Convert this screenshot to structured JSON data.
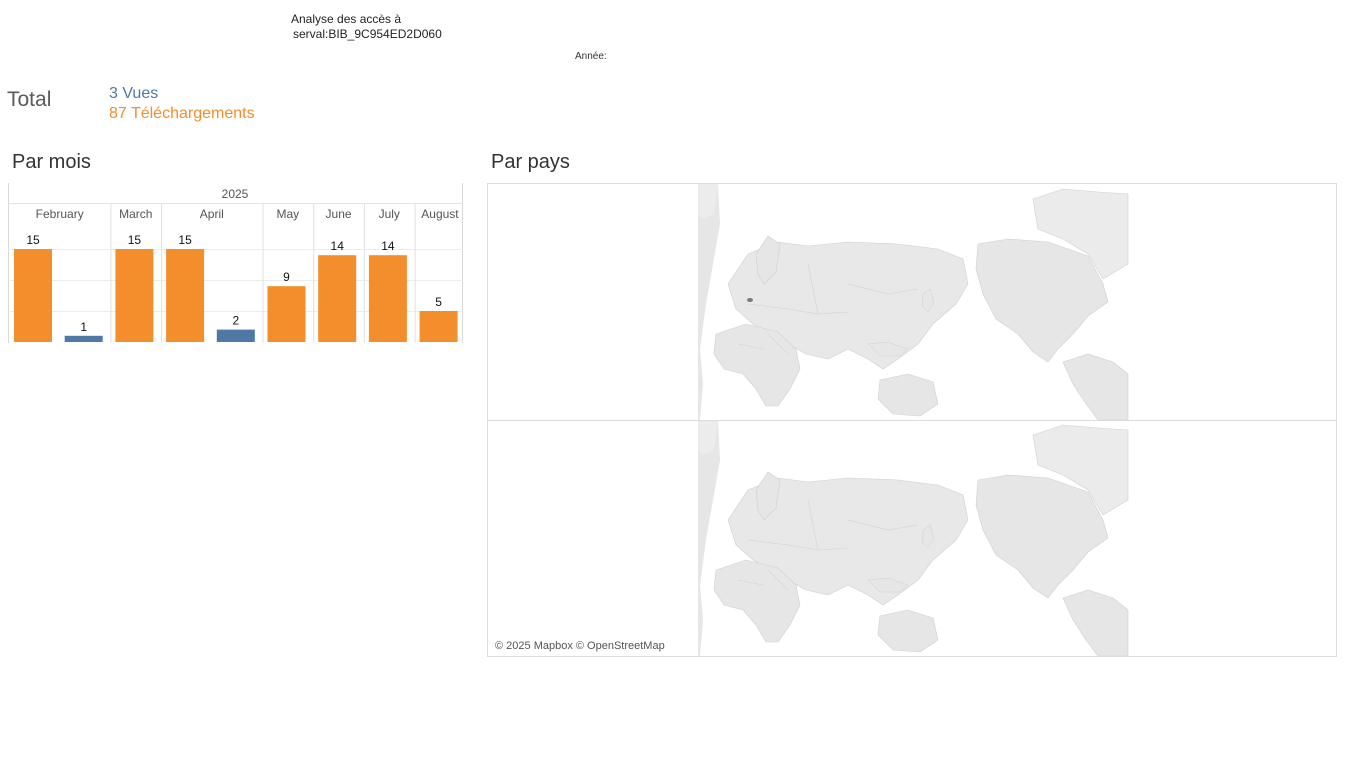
{
  "header": {
    "title_line1": "Analyse des accès à",
    "title_line2": "serval:BIB_9C954ED2D060",
    "year_filter_label": "Année:"
  },
  "totals": {
    "label": "Total",
    "vues": "3 Vues",
    "telechargements": "87 Téléchargements"
  },
  "sections": {
    "by_month": "Par mois",
    "by_country": "Par pays"
  },
  "colors": {
    "vues": "#4e79a7",
    "telechargements": "#f28e2b"
  },
  "chart_data": {
    "type": "bar",
    "year": "2025",
    "categories": [
      "February",
      "March",
      "April",
      "May",
      "June",
      "July",
      "August"
    ],
    "series": [
      {
        "name": "Téléchargements",
        "values": [
          15,
          15,
          15,
          9,
          14,
          14,
          5
        ]
      },
      {
        "name": "Vues",
        "values": [
          1,
          null,
          2,
          null,
          null,
          null,
          null
        ]
      }
    ],
    "ylim": [
      0,
      15
    ]
  },
  "map": {
    "attribution": "© 2025 Mapbox © OpenStreetMap",
    "highlighted_country": "Switzerland"
  }
}
